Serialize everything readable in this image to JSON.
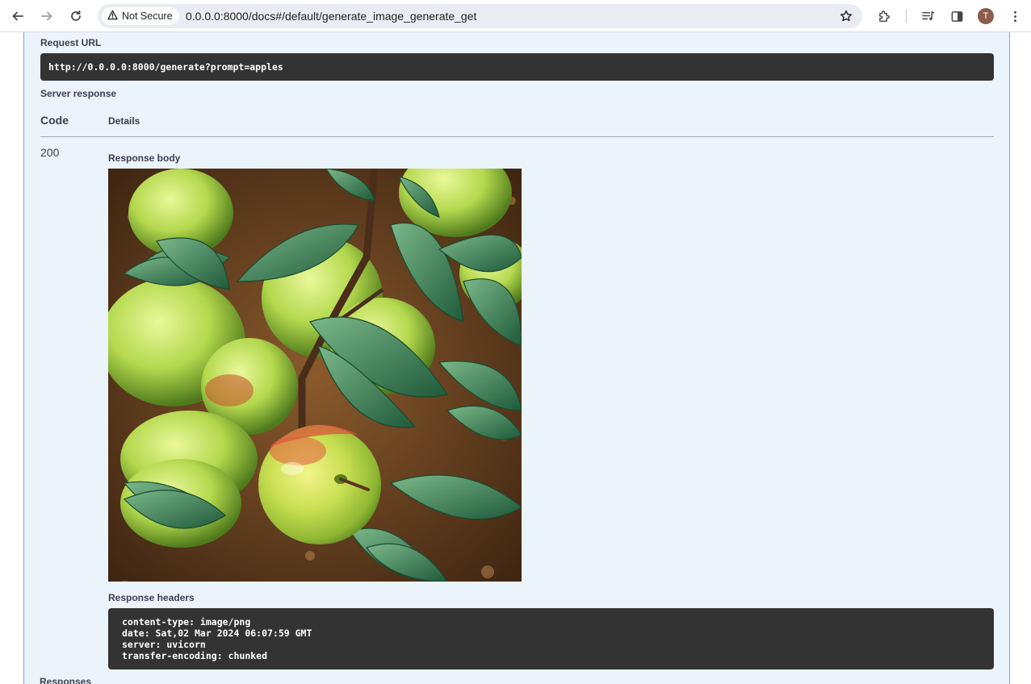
{
  "browser": {
    "security_label": "Not Secure",
    "url": "0.0.0.0:8000/docs#/default/generate_image_generate_get",
    "profile_initial": "T"
  },
  "panel": {
    "request_url_label": "Request URL",
    "request_url": "http://0.0.0.0:8000/generate?prompt=apples",
    "server_response_label": "Server response",
    "table": {
      "col_code": "Code",
      "col_details": "Details"
    },
    "status_code": "200",
    "response_body_label": "Response body",
    "response_headers_label": "Response headers",
    "response_headers": [
      "content-type: image/png",
      "date: Sat,02 Mar 2024 06:07:59 GMT",
      "server: uvicorn",
      "transfer-encoding: chunked"
    ]
  },
  "responses_label": "Responses",
  "icons": [
    "back-arrow-icon",
    "forward-arrow-icon",
    "reload-icon",
    "warning-icon",
    "star-icon",
    "extensions-icon",
    "media-queue-icon",
    "side-panel-icon",
    "kebab-menu-icon"
  ],
  "colors": {
    "panel_bg": "#ebf3fb",
    "panel_border": "#61affe",
    "code_bg": "#333333"
  }
}
